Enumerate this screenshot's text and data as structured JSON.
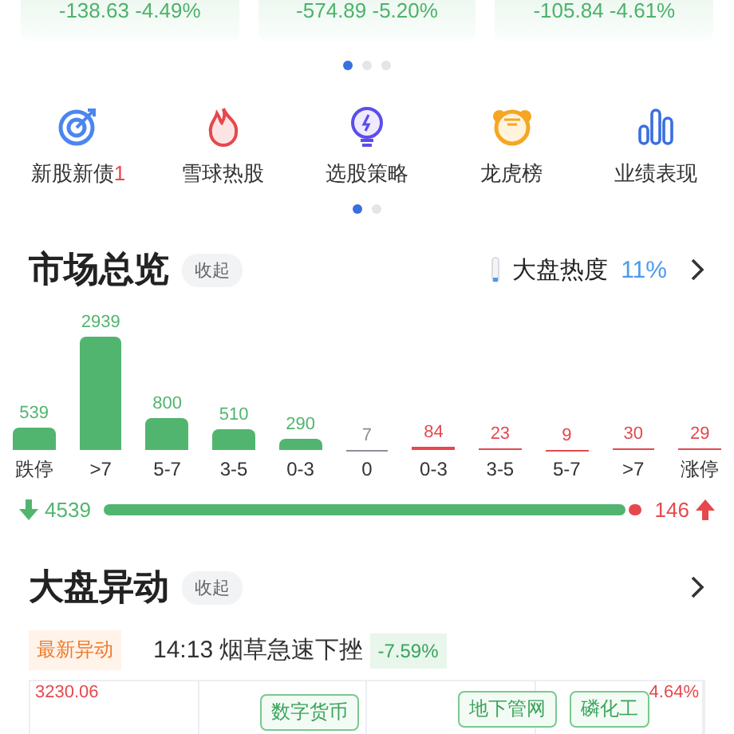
{
  "index_cards": [
    {
      "change": "-138.63 -4.49%"
    },
    {
      "change": "-574.89 -5.20%"
    },
    {
      "change": "-105.84 -4.61%"
    }
  ],
  "card_pager": [
    {
      "selected": true
    },
    {
      "selected": false
    },
    {
      "selected": false
    }
  ],
  "shortcuts": [
    {
      "kind": "target",
      "label": "新股新债",
      "count": "1"
    },
    {
      "kind": "flame",
      "label": "雪球热股"
    },
    {
      "kind": "bulb",
      "label": "选股策略"
    },
    {
      "kind": "tiger",
      "label": "龙虎榜"
    },
    {
      "kind": "bars",
      "label": "业绩表现"
    }
  ],
  "shortcut_pager": [
    {
      "selected": true
    },
    {
      "selected": false
    }
  ],
  "market_overview": {
    "title": "市场总览",
    "collapse": "收起",
    "heat_label": "大盘热度",
    "heat_value": "11%",
    "chart_data": {
      "type": "bar",
      "categories": [
        "跌停",
        ">7",
        "5-7",
        "3-5",
        "0-3",
        "0",
        "0-3",
        "3-5",
        "5-7",
        ">7",
        "涨停"
      ],
      "data_labels": true,
      "series": [
        {
          "color": "#52b56f",
          "values": [
            539,
            2939,
            800,
            510,
            290,
            null,
            null,
            null,
            null,
            null,
            null
          ]
        },
        {
          "color": "#8a8f99",
          "values": [
            null,
            null,
            null,
            null,
            null,
            7,
            null,
            null,
            null,
            null,
            null
          ]
        },
        {
          "color": "#e5484d",
          "values": [
            null,
            null,
            null,
            null,
            null,
            null,
            84,
            23,
            9,
            30,
            29
          ]
        }
      ]
    },
    "down_total": "4539",
    "up_total": "146",
    "level": 0.97
  },
  "market_moves": {
    "title": "大盘异动",
    "collapse": "收起",
    "latest_tag": "最新异动",
    "latest_text": "14:13 烟草急速下挫",
    "latest_change": "-7.59%",
    "chart_high": "3230.06",
    "chart_pct": "4.64%",
    "tags": [
      {
        "label": "数字货币"
      },
      {
        "label": "地下管网"
      },
      {
        "label": "磷化工"
      }
    ]
  }
}
